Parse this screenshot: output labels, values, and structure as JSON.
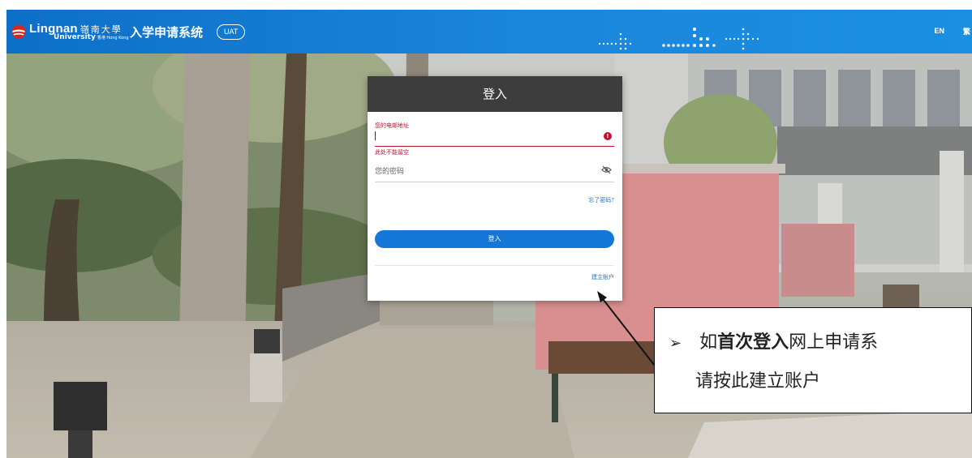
{
  "header": {
    "logo_en": "Lingnan",
    "logo_zh": "嶺南大學",
    "logo_sub": "University",
    "logo_sub_small": "香港 Hong Kong",
    "system_title": "入学申请系统",
    "env_badge": "UAT",
    "lang_en": "EN",
    "lang_tc": "繁"
  },
  "login": {
    "title": "登入",
    "email_label": "您的电邮地址",
    "email_value": "",
    "email_error": "此处不能留空",
    "password_placeholder": "您的密码",
    "forgot_link": "忘了密码?",
    "login_button": "登入",
    "create_account_link": "建立账户"
  },
  "annotation": {
    "bullet": "➢",
    "line1_pre": "如",
    "line1_bold": "首次登入",
    "line1_post": "网上申请系",
    "line2": "请按此建立账户"
  },
  "colors": {
    "header_blue": "#1a86dc",
    "card_header": "#3d3d3d",
    "error_red": "#c8102e",
    "primary_button": "#1577d8",
    "link_blue": "#1a73c8"
  },
  "icons": {
    "logo": "lingnan-logo-icon",
    "error": "error-icon",
    "password_toggle": "eye-slash-icon"
  }
}
